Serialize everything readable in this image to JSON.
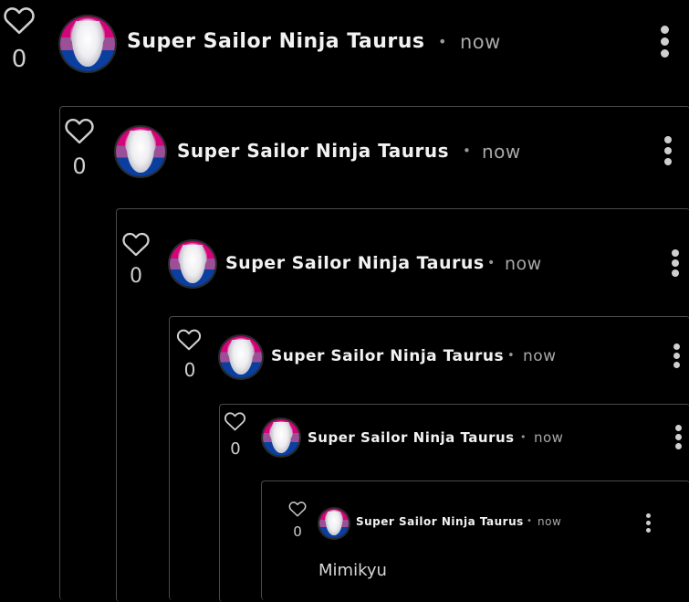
{
  "comments": [
    {
      "author": "Super Sailor Ninja Taurus",
      "separator": "•",
      "time": "now",
      "likes": "0"
    },
    {
      "author": "Super Sailor Ninja Taurus",
      "separator": "•",
      "time": "now",
      "likes": "0"
    },
    {
      "author": "Super Sailor Ninja Taurus",
      "separator": "•",
      "time": "now",
      "likes": "0"
    },
    {
      "author": "Super Sailor Ninja Taurus",
      "separator": "•",
      "time": "now",
      "likes": "0"
    },
    {
      "author": "Super Sailor Ninja Taurus",
      "separator": "•",
      "time": "now",
      "likes": "0"
    },
    {
      "author": "Super Sailor Ninja Taurus",
      "separator": "•",
      "time": "now",
      "likes": "0",
      "text": "Mimikyu"
    }
  ],
  "icons": {
    "like": "heart-outline-icon",
    "menu": "kebab-menu-icon"
  },
  "colors": {
    "background": "#000000",
    "border": "#4a4a4a",
    "text": "#f2f2f2",
    "muted": "#a8a8a8",
    "avatar_stripes": [
      "#d2057a",
      "#9b4f96",
      "#0a3fa0"
    ]
  }
}
